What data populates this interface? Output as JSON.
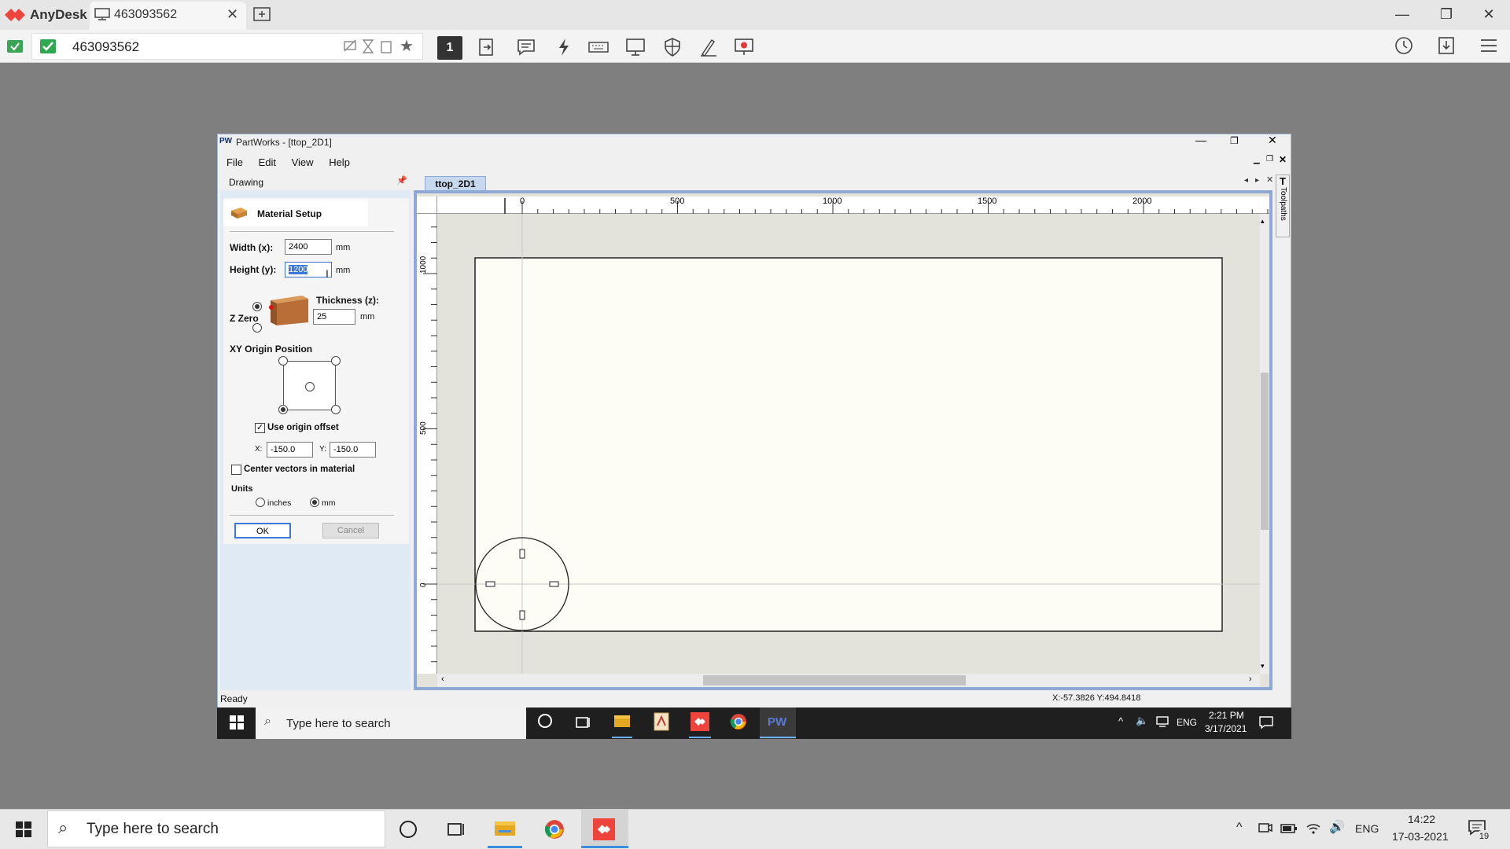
{
  "anydesk": {
    "app_name": "AnyDesk",
    "tab_label": "463093562",
    "address": "463093562",
    "toolbar_number": "1",
    "colors": {
      "brand": "#ef443b"
    }
  },
  "partworks": {
    "window_title": "PartWorks - [ttop_2D1]",
    "menu": [
      "File",
      "Edit",
      "View",
      "Help"
    ],
    "panel_title": "Drawing",
    "section_title": "Material Setup",
    "width_label": "Width (x):",
    "width_value": "2400",
    "height_label": "Height (y):",
    "height_value": "1200",
    "unit_mm": "mm",
    "z_zero_label": "Z Zero",
    "thickness_label": "Thickness (z):",
    "thickness_value": "25",
    "xy_origin_label": "XY Origin Position",
    "use_origin_offset_label": "Use origin offset",
    "x_label": "X:",
    "x_value": "-150.0",
    "y_label": "Y:",
    "y_value": "-150.0",
    "center_vectors_label": "Center vectors in material",
    "units_label": "Units",
    "units_inches": "inches",
    "units_mm": "mm",
    "ok_label": "OK",
    "cancel_label": "Cancel",
    "doc_tab": "ttop_2D1",
    "toolpaths_tab": "Toolpaths",
    "ruler_top_labels": [
      "0",
      "500",
      "1000",
      "1500",
      "2000"
    ],
    "ruler_left_labels": [
      "1000",
      "500",
      "0"
    ],
    "status": "Ready",
    "coords": "X:-57.3826 Y:494.8418"
  },
  "remote_taskbar": {
    "search_placeholder": "Type here to search",
    "lang": "ENG",
    "time": "2:21 PM",
    "date": "3/17/2021",
    "pw_label": "PW"
  },
  "local_taskbar": {
    "search_placeholder": "Type here to search",
    "lang": "ENG",
    "time": "14:22",
    "date": "17-03-2021",
    "notification_count": "19"
  }
}
